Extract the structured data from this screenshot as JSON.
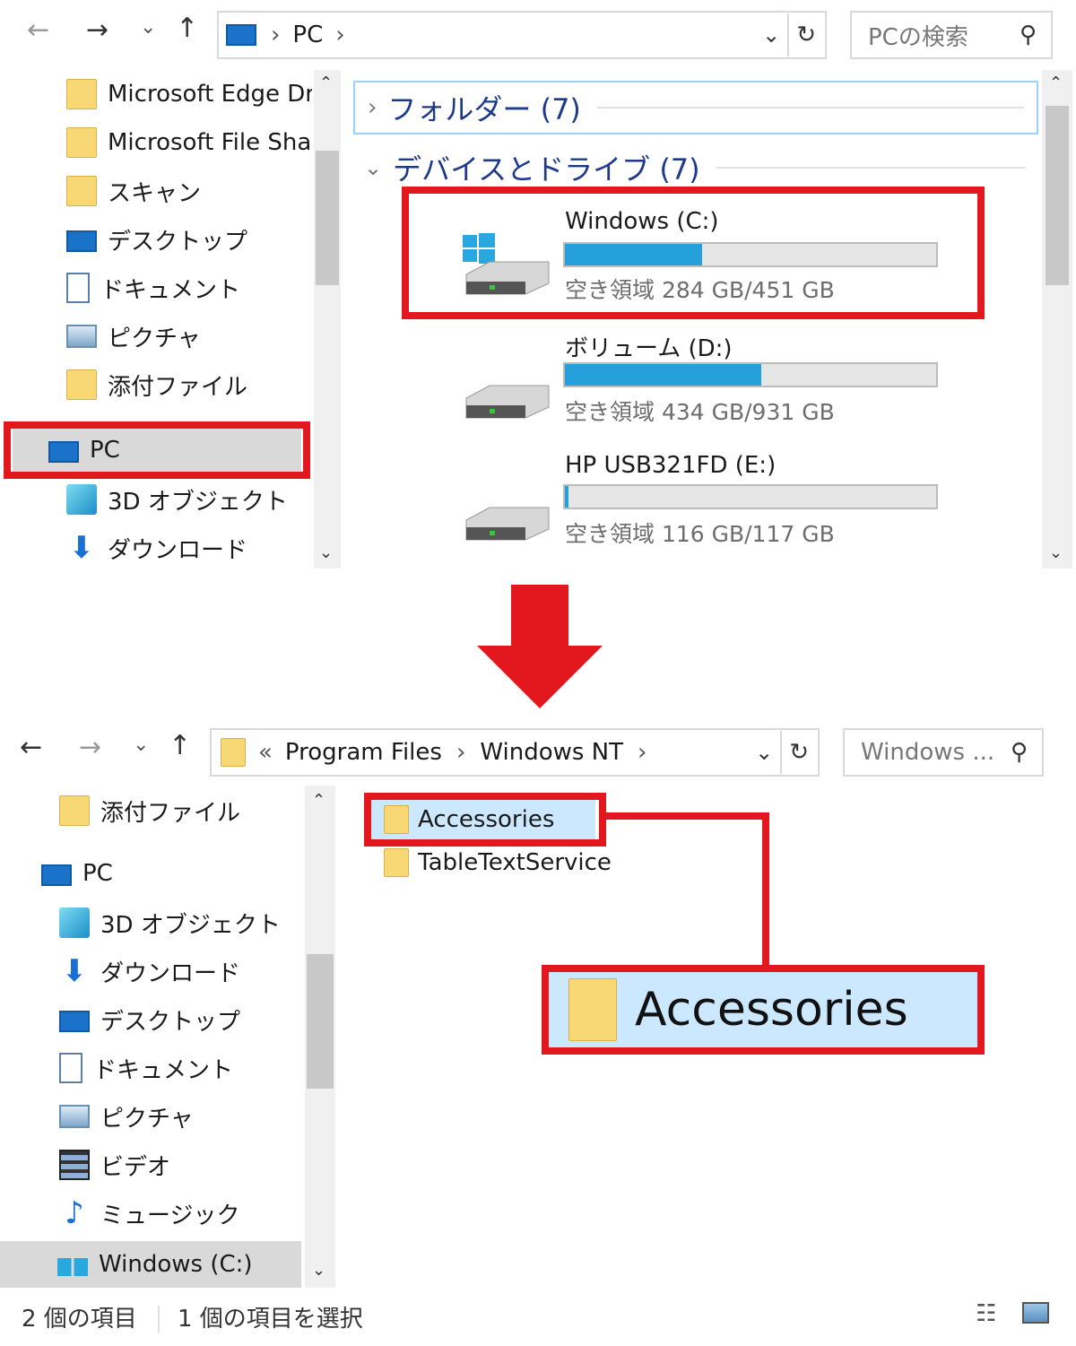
{
  "top": {
    "address": {
      "segment": "PC",
      "sep": "›"
    },
    "search": {
      "placeholder": "PCの検索"
    },
    "tree": [
      {
        "label": "Microsoft Edge Drc",
        "icon": "folder-icon"
      },
      {
        "label": "Microsoft File Shar",
        "icon": "folder-icon"
      },
      {
        "label": "スキャン",
        "icon": "folder-icon"
      },
      {
        "label": "デスクトップ",
        "icon": "desktop-icon"
      },
      {
        "label": "ドキュメント",
        "icon": "document-icon"
      },
      {
        "label": "ピクチャ",
        "icon": "picture-icon"
      },
      {
        "label": "添付ファイル",
        "icon": "folder-icon"
      },
      {
        "label": "PC",
        "icon": "pc-icon"
      },
      {
        "label": "3D オブジェクト",
        "icon": "cube-icon"
      },
      {
        "label": "ダウンロード",
        "icon": "download-icon"
      }
    ],
    "groups": {
      "folders": "フォルダー (7)",
      "devices": "デバイスとドライブ (7)"
    },
    "drives": [
      {
        "name": "Windows (C:)",
        "free": "空き領域 284 GB/451 GB",
        "used_fraction": 0.37
      },
      {
        "name": "ボリューム (D:)",
        "free": "空き領域 434 GB/931 GB",
        "used_fraction": 0.53
      },
      {
        "name": "HP USB321FD (E:)",
        "free": "空き領域 116 GB/117 GB",
        "used_fraction": 0.01
      }
    ]
  },
  "bottom": {
    "address": {
      "prefix": "«",
      "seg1": "Program Files",
      "sep": "›",
      "seg2": "Windows NT"
    },
    "search": {
      "placeholder": "Windows ..."
    },
    "tree": [
      {
        "label": "添付ファイル",
        "icon": "folder-icon"
      },
      {
        "label": "PC",
        "icon": "pc-icon"
      },
      {
        "label": "3D オブジェクト",
        "icon": "cube-icon"
      },
      {
        "label": "ダウンロード",
        "icon": "download-icon"
      },
      {
        "label": "デスクトップ",
        "icon": "desktop-icon"
      },
      {
        "label": "ドキュメント",
        "icon": "document-icon"
      },
      {
        "label": "ピクチャ",
        "icon": "picture-icon"
      },
      {
        "label": "ビデオ",
        "icon": "video-icon"
      },
      {
        "label": "ミュージック",
        "icon": "music-icon"
      },
      {
        "label": "Windows (C:)",
        "icon": "drive-icon"
      }
    ],
    "files": [
      "Accessories",
      "TableTextService"
    ],
    "zoom_label": "Accessories",
    "status": {
      "count": "2 個の項目",
      "selected": "1 個の項目を選択"
    }
  },
  "colors": {
    "highlight_red": "#e3181f",
    "selection_blue": "#cce8ff",
    "accent_blue": "#26a0da"
  }
}
